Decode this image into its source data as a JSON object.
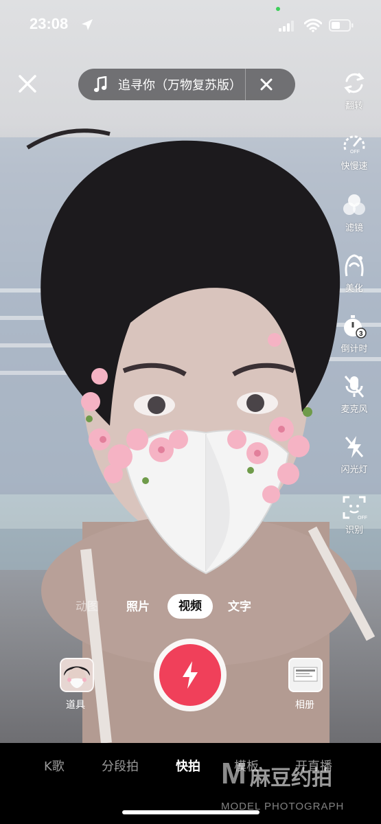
{
  "status_bar": {
    "time": "23:08",
    "icons": [
      "location-arrow-icon",
      "signal-icon",
      "wifi-icon",
      "battery-icon"
    ]
  },
  "music": {
    "title": "追寻你（万物复苏版）",
    "icon": "music-note-icon"
  },
  "right_tools": [
    {
      "name": "flip",
      "label": "翻转",
      "icon": "flip-camera-icon"
    },
    {
      "name": "speed",
      "label": "快慢速",
      "icon": "speed-dial-icon",
      "badge": "OFF"
    },
    {
      "name": "filter",
      "label": "滤镜",
      "icon": "filter-circles-icon"
    },
    {
      "name": "beautify",
      "label": "美化",
      "icon": "beauty-icon"
    },
    {
      "name": "countdown",
      "label": "倒计时",
      "icon": "timer-icon",
      "badge": "3"
    },
    {
      "name": "microphone",
      "label": "麦克风",
      "icon": "mic-off-icon"
    },
    {
      "name": "flash",
      "label": "闪光灯",
      "icon": "flash-off-icon"
    },
    {
      "name": "recognize",
      "label": "识别",
      "icon": "face-scan-icon",
      "badge": "OFF"
    }
  ],
  "capture_modes": [
    "动图",
    "照片",
    "视频",
    "文字"
  ],
  "active_mode": "视频",
  "props": {
    "label": "道具"
  },
  "album": {
    "label": "相册"
  },
  "bottom_tabs": [
    "K歌",
    "分段拍",
    "快拍",
    "模板",
    "开直播"
  ],
  "active_tab": "快拍",
  "watermark": {
    "mark": "M",
    "cn": "麻豆约拍",
    "en": "MODEL PHOTOGRAPH"
  },
  "colors": {
    "shutter": "#f0405a",
    "accent": "#ffffff",
    "bar": "#000000"
  }
}
